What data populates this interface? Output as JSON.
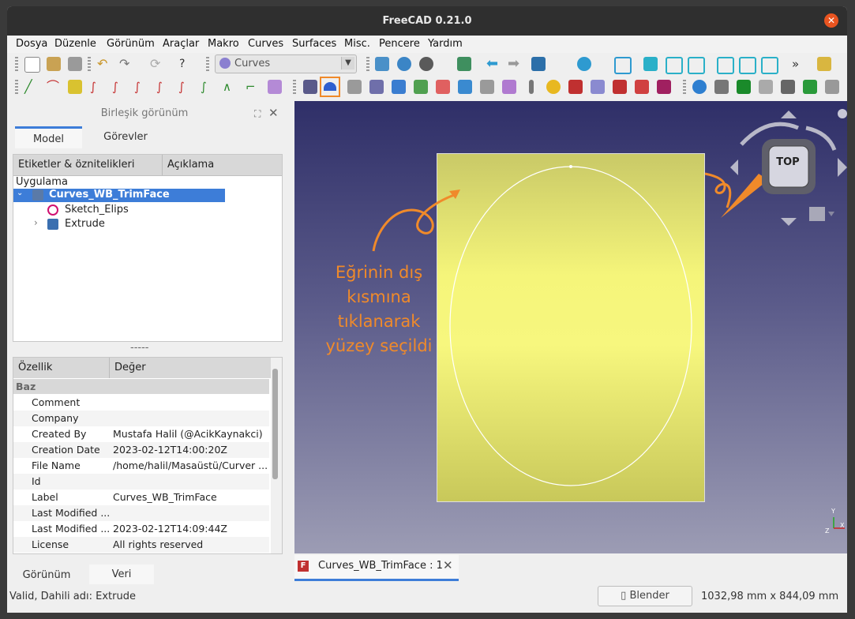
{
  "window": {
    "title": "FreeCAD 0.21.0"
  },
  "menu": [
    "Dosya",
    "Düzenle",
    "Görünüm",
    "Araçlar",
    "Makro",
    "Curves",
    "Surfaces",
    "Misc.",
    "Pencere",
    "Yardım"
  ],
  "toolbar": {
    "workbench_selected": "Curves",
    "more": "»"
  },
  "combo_view": {
    "title": "Birleşik görünüm",
    "tabs": [
      "Model",
      "Görevler"
    ],
    "tree_headers": [
      "Etiketler & öznitelikleri",
      "Açıklama"
    ],
    "tree": {
      "root": "Uygulama",
      "document": "Curves_WB_TrimFace",
      "children": [
        "Sketch_Elips",
        "Extrude"
      ]
    },
    "splitter": "-----",
    "property_headers": [
      "Özellik",
      "Değer"
    ],
    "group": "Baz",
    "properties": [
      {
        "key": "Comment",
        "value": ""
      },
      {
        "key": "Company",
        "value": ""
      },
      {
        "key": "Created By",
        "value": "Mustafa Halil (@AcikKaynakci)"
      },
      {
        "key": "Creation Date",
        "value": "2023-02-12T14:00:20Z"
      },
      {
        "key": "File Name",
        "value": "/home/halil/Masaüstü/Curver ..."
      },
      {
        "key": "Id",
        "value": ""
      },
      {
        "key": "Label",
        "value": "Curves_WB_TrimFace"
      },
      {
        "key": "Last Modified ...",
        "value": ""
      },
      {
        "key": "Last Modified ...",
        "value": "2023-02-12T14:09:44Z"
      },
      {
        "key": "License",
        "value": "All rights reserved"
      }
    ],
    "bottom_tabs": [
      "Görünüm",
      "Veri"
    ]
  },
  "viewport": {
    "annotation": [
      "Eğrinin dış",
      "kısmına",
      "tıklanarak",
      "yüzey seçildi"
    ],
    "navcube_label": "TOP",
    "axis_labels": [
      "Y",
      "Z",
      "X"
    ]
  },
  "document_tab": "Curves_WB_TrimFace : 1",
  "status": {
    "message": "Valid, Dahili adı: Extrude",
    "navigation": "Blender",
    "dimensions": "1032,98 mm x 844,09 mm"
  },
  "colors": {
    "accent": "#3d7dd8",
    "annotation": "#f08a2a",
    "highlight_box": "#f08a2a",
    "face": "#f5f57a",
    "selection": "#3d7dd8"
  }
}
